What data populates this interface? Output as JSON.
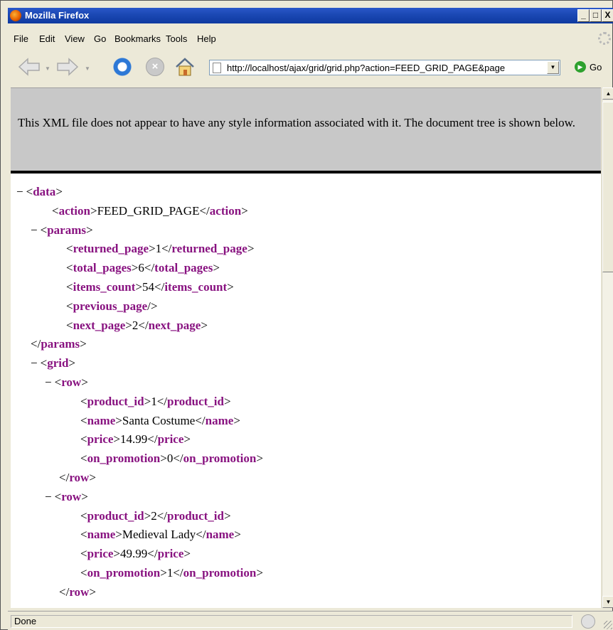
{
  "window": {
    "title": "Mozilla Firefox",
    "minimize": "_",
    "maximize": "□",
    "close": "X"
  },
  "menu": [
    "File",
    "Edit",
    "View",
    "Go",
    "Bookmarks",
    "Tools",
    "Help"
  ],
  "toolbar": {
    "url": "http://localhost/ajax/grid/grid.php?action=FEED_GRID_PAGE&page",
    "go_label": "Go",
    "icons": [
      "back-icon",
      "forward-icon",
      "reload-icon",
      "stop-icon",
      "home-icon",
      "page-icon",
      "go-icon"
    ]
  },
  "banner": {
    "message": "This XML file does not appear to have any style information associated with it. The document tree is shown below."
  },
  "xml": [
    {
      "toggle": "−",
      "open": "<data>",
      "text": "",
      "close": ""
    },
    {
      "toggle": "",
      "open": "<action>",
      "text": "FEED_GRID_PAGE",
      "close": "</action>"
    },
    {
      "toggle": "−",
      "open": "<params>",
      "text": "",
      "close": ""
    },
    {
      "toggle": "",
      "open": "<returned_page>",
      "text": "1",
      "close": "</returned_page>"
    },
    {
      "toggle": "",
      "open": "<total_pages>",
      "text": "6",
      "close": "</total_pages>"
    },
    {
      "toggle": "",
      "open": "<items_count>",
      "text": "54",
      "close": "</items_count>"
    },
    {
      "toggle": "",
      "open": "<previous_page/>",
      "text": "",
      "close": ""
    },
    {
      "toggle": "",
      "open": "<next_page>",
      "text": "2",
      "close": "</next_page>"
    },
    {
      "toggle": "",
      "open": "</params>",
      "text": "",
      "close": ""
    },
    {
      "toggle": "−",
      "open": "<grid>",
      "text": "",
      "close": ""
    },
    {
      "toggle": "−",
      "open": "<row>",
      "text": "",
      "close": ""
    },
    {
      "toggle": "",
      "open": "<product_id>",
      "text": "1",
      "close": "</product_id>"
    },
    {
      "toggle": "",
      "open": "<name>",
      "text": "Santa Costume",
      "close": "</name>"
    },
    {
      "toggle": "",
      "open": "<price>",
      "text": "14.99",
      "close": "</price>"
    },
    {
      "toggle": "",
      "open": "<on_promotion>",
      "text": "0",
      "close": "</on_promotion>"
    },
    {
      "toggle": "",
      "open": "</row>",
      "text": "",
      "close": ""
    },
    {
      "toggle": "−",
      "open": "<row>",
      "text": "",
      "close": ""
    },
    {
      "toggle": "",
      "open": "<product_id>",
      "text": "2",
      "close": "</product_id>"
    },
    {
      "toggle": "",
      "open": "<name>",
      "text": "Medieval Lady",
      "close": "</name>"
    },
    {
      "toggle": "",
      "open": "<price>",
      "text": "49.99",
      "close": "</price>"
    },
    {
      "toggle": "",
      "open": "<on_promotion>",
      "text": "1",
      "close": "</on_promotion>"
    },
    {
      "toggle": "",
      "open": "</row>",
      "text": "",
      "close": ""
    }
  ],
  "status": {
    "text": "Done"
  }
}
